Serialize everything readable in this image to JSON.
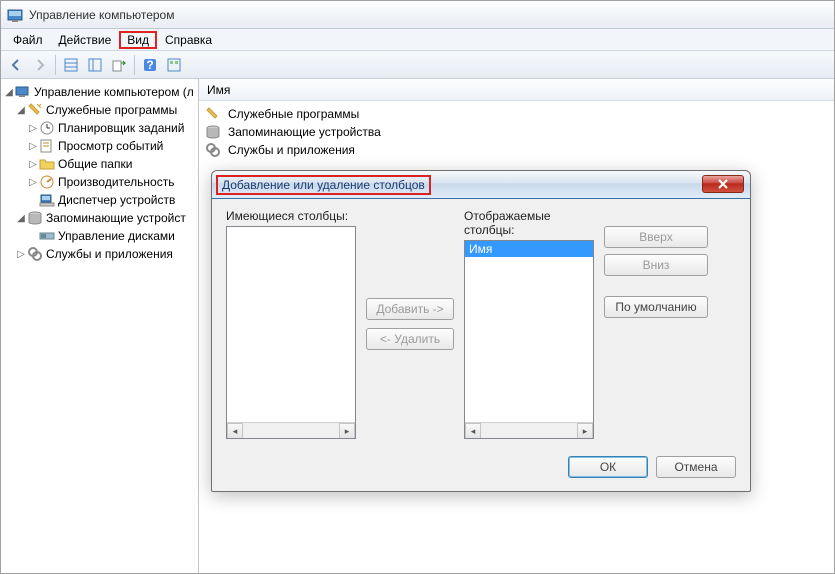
{
  "window": {
    "title": "Управление компьютером"
  },
  "menubar": {
    "file": "Файл",
    "action": "Действие",
    "view": "Вид",
    "help": "Справка"
  },
  "tree": {
    "root": "Управление компьютером (л",
    "group1": "Служебные программы",
    "g1_task": "Планировщик заданий",
    "g1_event": "Просмотр событий",
    "g1_shared": "Общие папки",
    "g1_perf": "Производительность",
    "g1_devmgr": "Диспетчер устройств",
    "group2": "Запоминающие устройст",
    "g2_disk": "Управление дисками",
    "group3": "Службы и приложения"
  },
  "list": {
    "header": "Имя",
    "row1": "Служебные программы",
    "row2": "Запоминающие устройства",
    "row3": "Службы и приложения"
  },
  "dialog": {
    "title": "Добавление или удаление столбцов",
    "available_label": "Имеющиеся столбцы:",
    "displayed_label": "Отображаемые столбцы:",
    "displayed_item": "Имя",
    "btn_add": "Добавить ->",
    "btn_remove": "<- Удалить",
    "btn_up": "Вверх",
    "btn_down": "Вниз",
    "btn_default": "По умолчанию",
    "btn_ok": "ОК",
    "btn_cancel": "Отмена"
  }
}
